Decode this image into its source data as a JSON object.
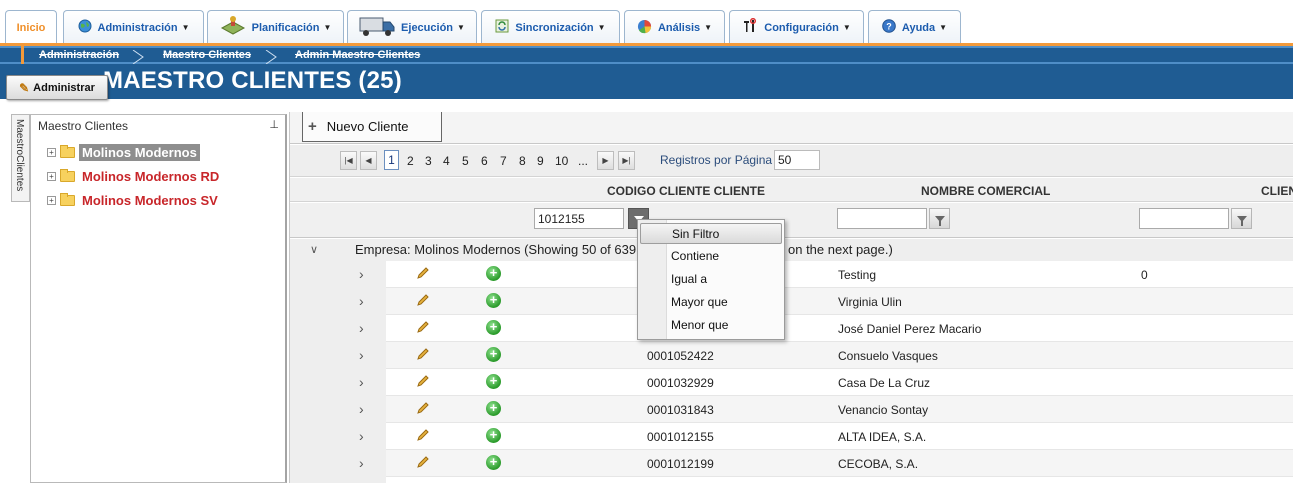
{
  "nav": {
    "tabs": [
      {
        "label": "Inicio",
        "icon": "none"
      },
      {
        "label": "Administración",
        "icon": "globe-icon"
      },
      {
        "label": "Planificación",
        "icon": "map-icon"
      },
      {
        "label": "Ejecución",
        "icon": "truck-icon"
      },
      {
        "label": "Sincronización",
        "icon": "sync-icon"
      },
      {
        "label": "Análisis",
        "icon": "pie-chart-icon"
      },
      {
        "label": "Configuración",
        "icon": "tools-icon"
      },
      {
        "label": "Ayuda",
        "icon": "help-icon"
      }
    ]
  },
  "breadcrumb": [
    "Administración",
    "Maestro Clientes",
    "Admin Maestro Clientes"
  ],
  "page": {
    "title": "MAESTRO CLIENTES (25)",
    "admin_button": "Administrar"
  },
  "sidetab": {
    "label": "MaestroClientes"
  },
  "tree": {
    "title": "Maestro Clientes",
    "nodes": [
      {
        "label": "Molinos Modernos",
        "selected": true
      },
      {
        "label": "Molinos Modernos RD",
        "selected": false
      },
      {
        "label": "Molinos Modernos SV",
        "selected": false
      }
    ]
  },
  "toolbar": {
    "new_button": "Nuevo Cliente"
  },
  "pager": {
    "pages": [
      "1",
      "2",
      "3",
      "4",
      "5",
      "6",
      "7",
      "8",
      "9",
      "10",
      "..."
    ],
    "current_page": "1",
    "records_label": "Registros por Página",
    "records_value": "50"
  },
  "grid": {
    "columns": [
      "CODIGO CLIENTE CLIENTE",
      "NOMBRE COMERCIAL",
      "CLIEN"
    ],
    "filter_value_codigo": "1012155",
    "group_label": "Empresa: Molinos Modernos (Showing 50 of 639",
    "group_label_tail": "on the next page.)",
    "rows": [
      {
        "codigo": "",
        "nombre": "Testing",
        "extra": "0"
      },
      {
        "codigo": "",
        "nombre": "Virginia Ulin",
        "extra": ""
      },
      {
        "codigo": "",
        "nombre": "José Daniel Perez Macario",
        "extra": ""
      },
      {
        "codigo": "0001052422",
        "nombre": "Consuelo Vasques",
        "extra": ""
      },
      {
        "codigo": "0001032929",
        "nombre": "Casa De La Cruz",
        "extra": ""
      },
      {
        "codigo": "0001031843",
        "nombre": "Venancio Sontay",
        "extra": ""
      },
      {
        "codigo": "0001012155",
        "nombre": "ALTA IDEA, S.A.",
        "extra": ""
      },
      {
        "codigo": "0001012199",
        "nombre": "CECOBA, S.A.",
        "extra": ""
      }
    ]
  },
  "filter_menu": {
    "items": [
      "Sin Filtro",
      "Contiene",
      "Igual a",
      "Mayor que",
      "Menor que"
    ],
    "selected": "Sin Filtro"
  },
  "colors": {
    "brand_blue": "#1f5c93",
    "accent_orange": "#f39a3a",
    "tree_red": "#c8262a"
  }
}
